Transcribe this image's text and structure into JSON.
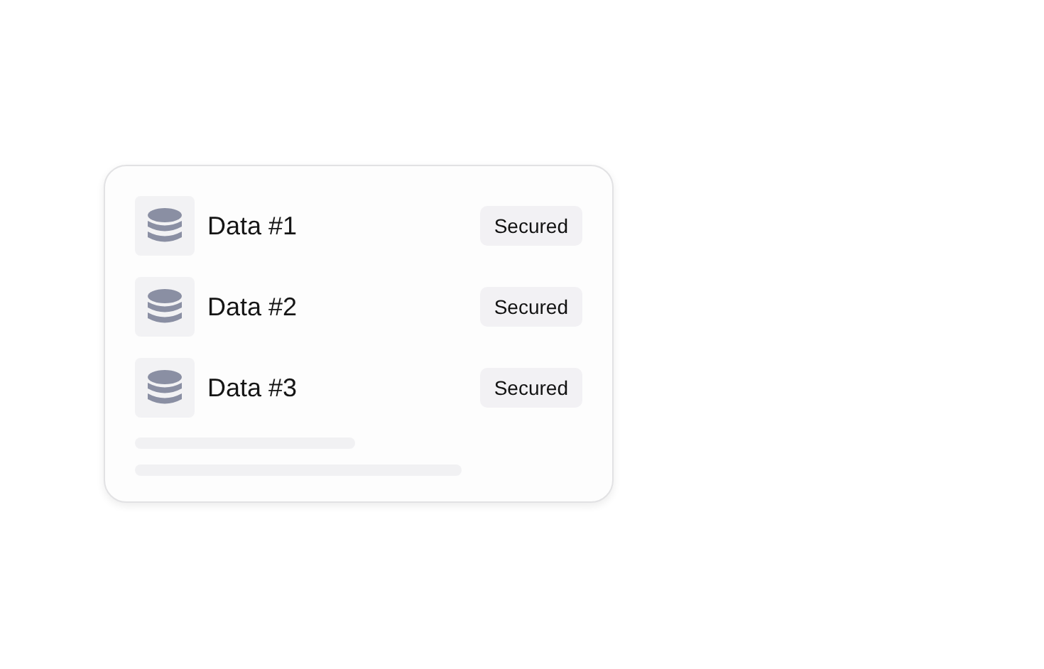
{
  "items": [
    {
      "name": "Data #1",
      "status": "Secured"
    },
    {
      "name": "Data #2",
      "status": "Secured"
    },
    {
      "name": "Data #3",
      "status": "Secured"
    }
  ]
}
